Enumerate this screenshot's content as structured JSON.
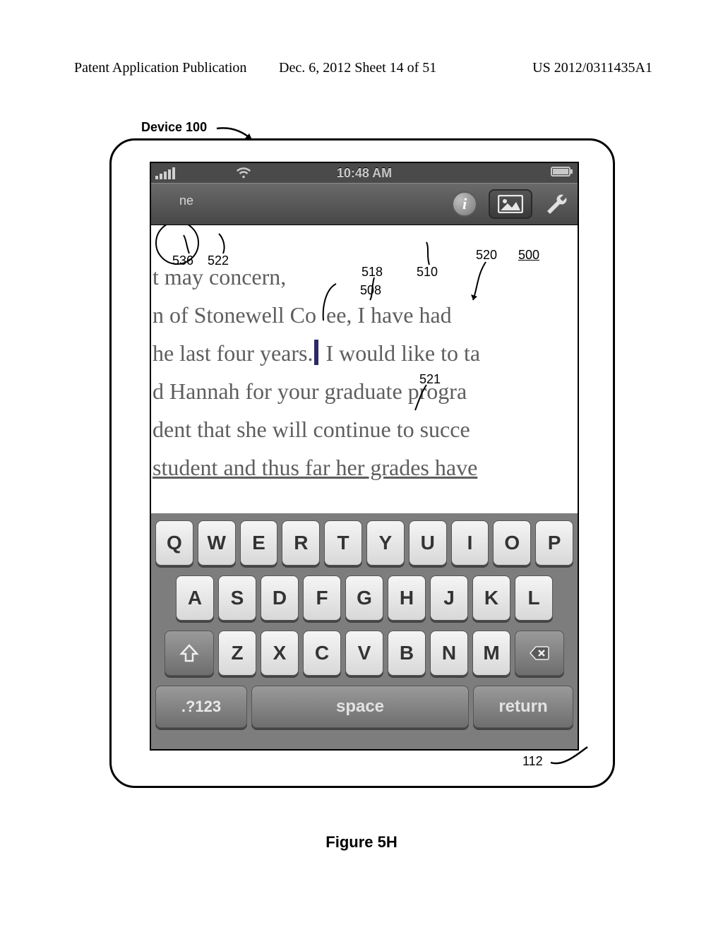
{
  "header": {
    "left": "Patent Application Publication",
    "mid": "Dec. 6, 2012  Sheet 14 of 51",
    "right": "US 2012/0311435A1"
  },
  "device_label": "Device 100",
  "figure_caption": "Figure 5H",
  "status": {
    "time": "10:48 AM"
  },
  "toolbar": {
    "tab_label": "ne",
    "info_glyph": "i"
  },
  "doc": {
    "line1": "t may concern,",
    "line2_a": "n of Stonewell Co",
    "line2_b": "e",
    "line2_c": "e, I have had",
    "line3_a": "he last four years.",
    "line3_b": " I would like to ta",
    "line4": "d Hannah for your graduate progra",
    "line5": "dent that she will continue to succe",
    "line6": "student and thus far her grades have"
  },
  "refs": {
    "r536": "536",
    "r522": "522",
    "r518": "518",
    "r508": "508",
    "r510": "510",
    "r520": "520",
    "r500": "500",
    "r521": "521",
    "r112": "112"
  },
  "keys": {
    "row1": [
      "Q",
      "W",
      "E",
      "R",
      "T",
      "Y",
      "U",
      "I",
      "O",
      "P"
    ],
    "row2": [
      "A",
      "S",
      "D",
      "F",
      "G",
      "H",
      "J",
      "K",
      "L"
    ],
    "row3": [
      "Z",
      "X",
      "C",
      "V",
      "B",
      "N",
      "M"
    ],
    "numsym": ".?123",
    "space": "space",
    "ret": "return"
  }
}
